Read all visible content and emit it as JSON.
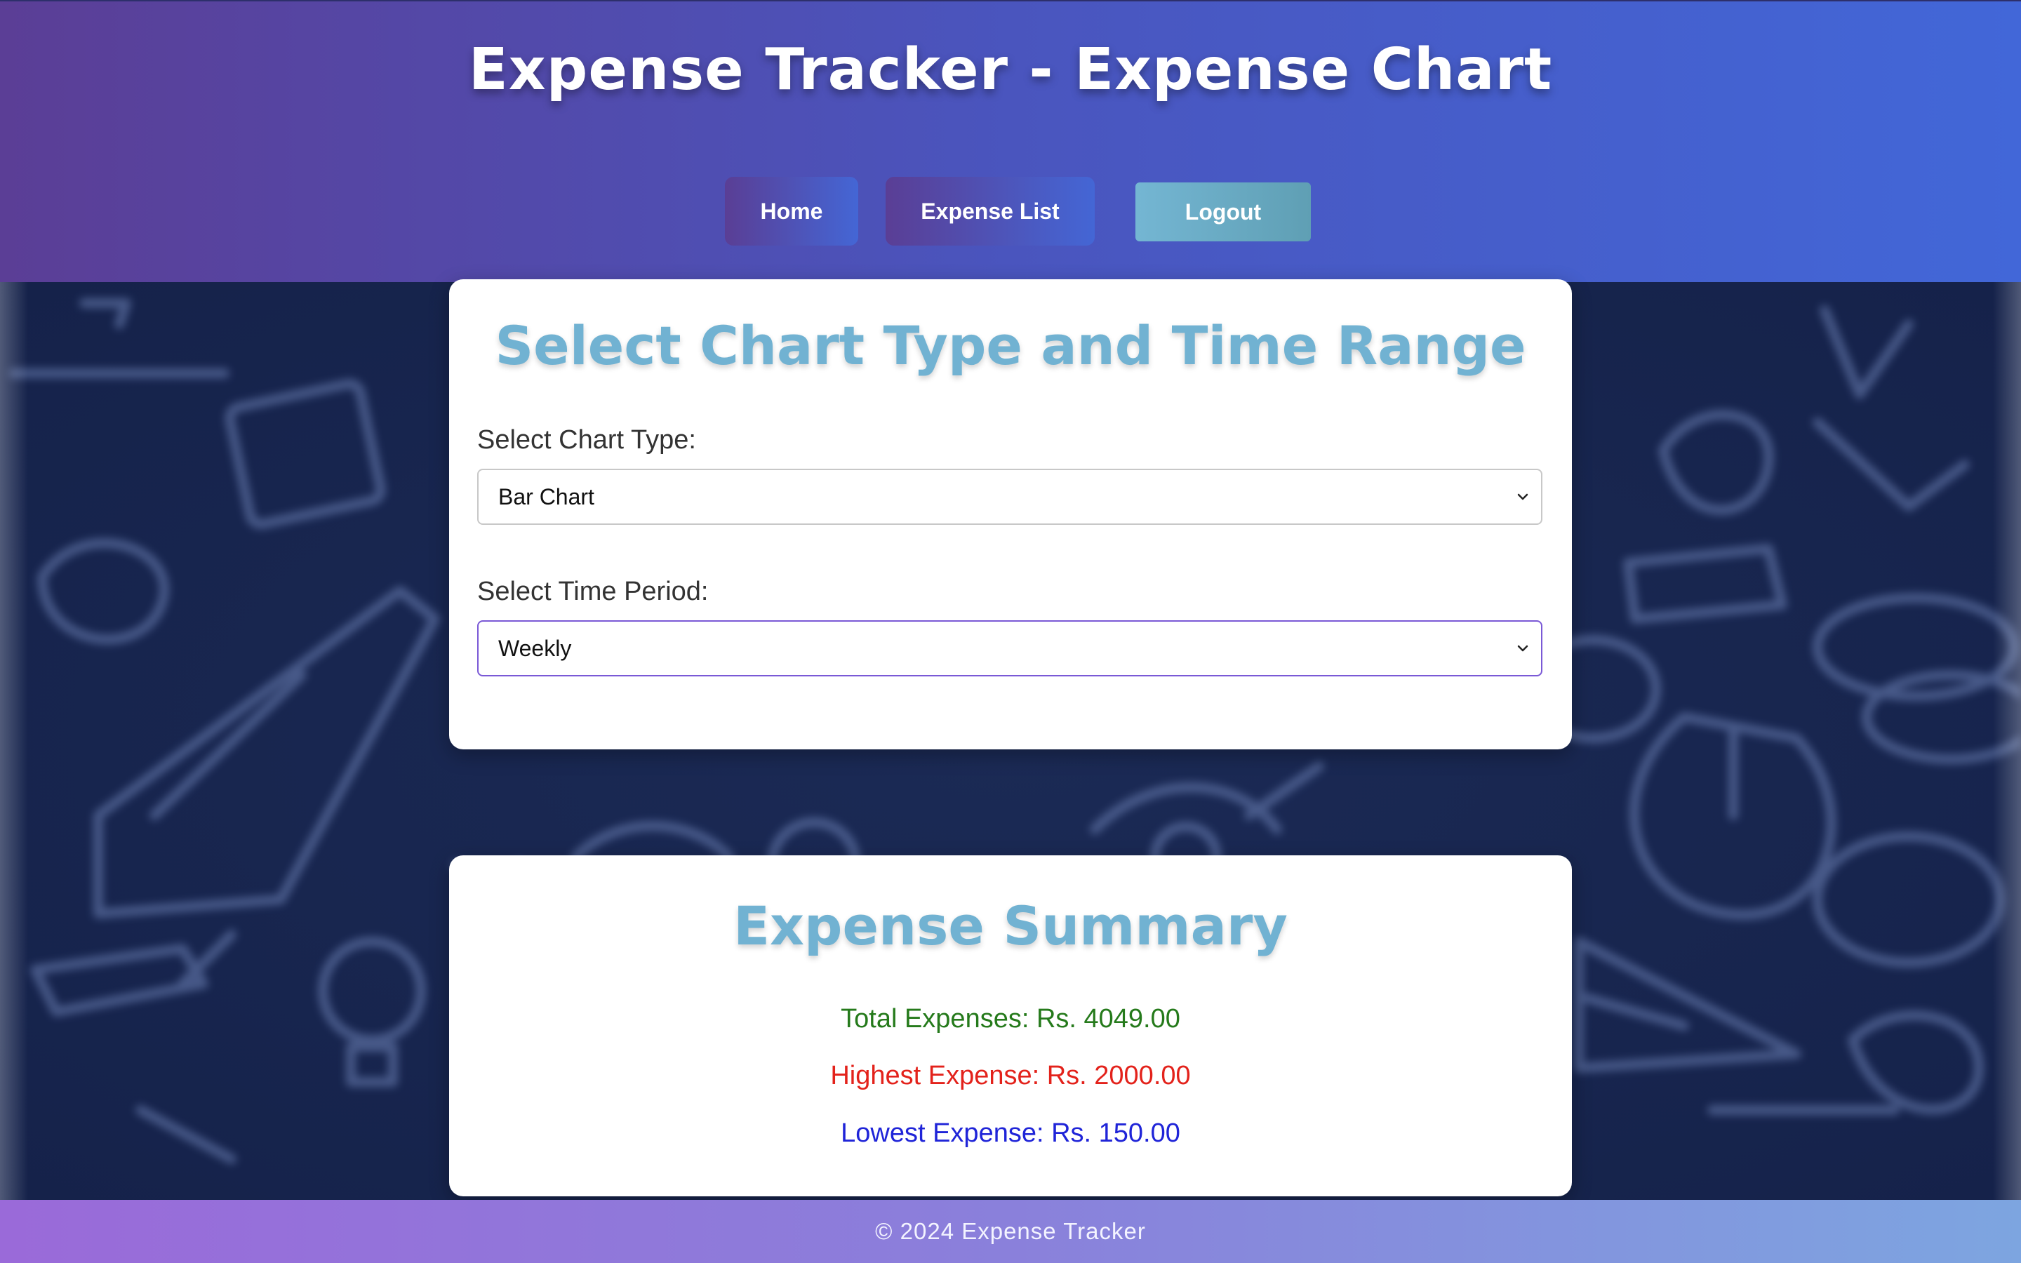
{
  "header": {
    "title": "Expense Tracker - Expense Chart",
    "nav": {
      "home_label": "Home",
      "expense_list_label": "Expense List",
      "logout_label": "Logout"
    }
  },
  "chart_selector": {
    "title": "Select Chart Type and Time Range",
    "chart_type_label": "Select Chart Type:",
    "chart_type_value": "Bar Chart",
    "time_period_label": "Select Time Period:",
    "time_period_value": "Weekly"
  },
  "summary": {
    "title": "Expense Summary",
    "total": "Total Expenses: Rs. 4049.00",
    "highest": "Highest Expense: Rs. 2000.00",
    "lowest": "Lowest Expense: Rs. 150.00"
  },
  "footer": {
    "text": "© 2024 Expense Tracker"
  },
  "colors": {
    "header_gradient_start": "#5b3e96",
    "header_gradient_end": "#4267d8",
    "card_title": "#71b2d2",
    "total_color": "#257a1b",
    "highest_color": "#e3221b",
    "lowest_color": "#1f24d8",
    "logout_button": "#74b6d3"
  }
}
